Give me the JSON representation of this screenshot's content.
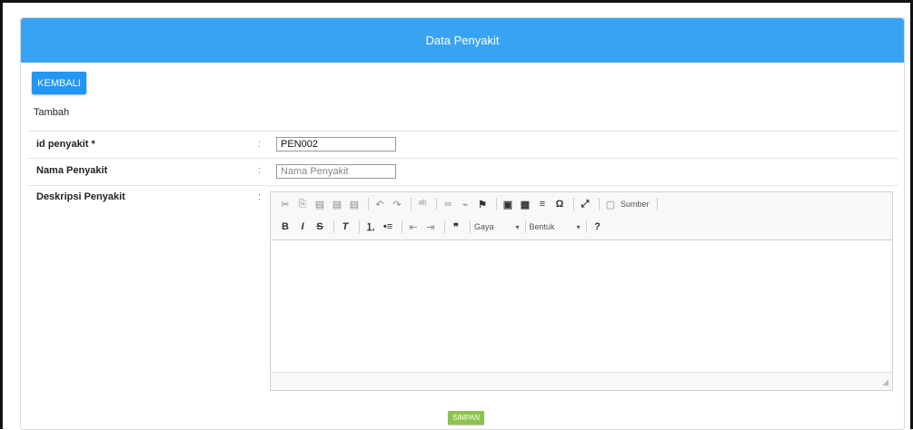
{
  "header": {
    "title": "Data Penyakit"
  },
  "actions": {
    "back_label": "KEMBALI",
    "save_label": "SIMPAN"
  },
  "form": {
    "subtitle": "Tambah",
    "separator": ":",
    "id_field": {
      "label": "id penyakit *",
      "value": "PEN002"
    },
    "name_field": {
      "label": "Nama Penyakit",
      "placeholder": "Nama Penyakit"
    },
    "desc_field": {
      "label": "Deskripsi Penyakit"
    }
  },
  "editor": {
    "source_label": "Sumber",
    "style_combo": "Gaya",
    "format_combo": "Bentuk",
    "toolbar_row1": [
      "cut-icon",
      "copy-icon",
      "paste-icon",
      "paste-text-icon",
      "paste-word-icon",
      "undo-icon",
      "redo-icon",
      "spellcheck-icon",
      "link-icon",
      "unlink-icon",
      "anchor-icon",
      "image-icon",
      "table-icon",
      "horizontal-rule-icon",
      "special-char-icon",
      "maximize-icon",
      "source-icon"
    ],
    "toolbar_row2": [
      "bold-icon",
      "italic-icon",
      "strike-icon",
      "remove-format-icon",
      "numbered-list-icon",
      "bulleted-list-icon",
      "outdent-icon",
      "indent-icon",
      "blockquote-icon",
      "help-icon"
    ]
  },
  "colors": {
    "header": "#38a4f1",
    "back_button": "#2196f3",
    "save_button": "#8bc34a"
  }
}
